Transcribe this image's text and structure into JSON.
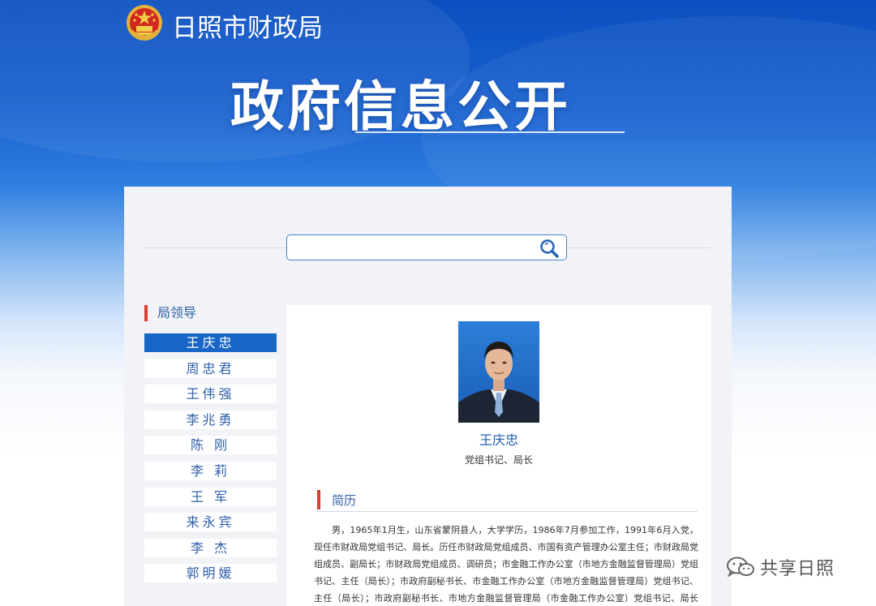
{
  "header": {
    "dept_name": "日照市财政局",
    "banner_title": "政府信息公开"
  },
  "search": {
    "placeholder": ""
  },
  "sidebar": {
    "heading": "局领导",
    "items": [
      {
        "label": "王庆忠"
      },
      {
        "label": "周忠君"
      },
      {
        "label": "王伟强"
      },
      {
        "label": "李兆勇"
      },
      {
        "label": "陈  刚"
      },
      {
        "label": "李  莉"
      },
      {
        "label": "王  军"
      },
      {
        "label": "来永宾"
      },
      {
        "label": "李  杰"
      },
      {
        "label": "郭明媛"
      }
    ],
    "active_index": 0
  },
  "profile": {
    "name": "王庆忠",
    "position": "党组书记、局长",
    "resume_heading": "简历",
    "bio": "男，1965年1月生，山东省蒙阴县人，大学学历，1986年7月参加工作，1991年6月入党，现任市财政局党组书记、局长。历任市财政局党组成员、市国有资产管理办公室主任；市财政局党组成员、副局长；市财政局党组成员、调研员；市金融工作办公室（市地方金融监督管理局）党组书记、主任（局长）；市政府副秘书长、市金融工作办公室（市地方金融监督管理局）党组书记、主任（局长）；市政府副秘书长、市地方金融监督管理局（市金融工作办公室）党组书记、局长（主任）。"
  },
  "watermark": {
    "text": "共享日照",
    "icon": "wechat-icon"
  },
  "colors": {
    "banner_blue": "#0c4fc0",
    "accent_red": "#d8402f",
    "link_blue": "#2e5fa8",
    "active_blue": "#1766c6"
  }
}
